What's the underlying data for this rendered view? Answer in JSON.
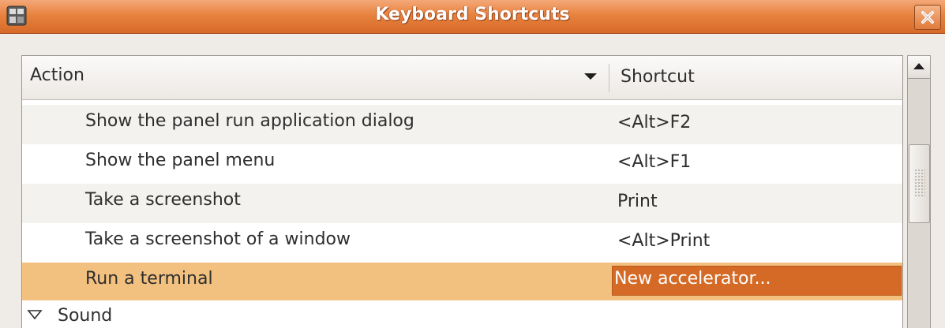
{
  "window": {
    "title": "Keyboard Shortcuts",
    "icon": "keyboard-shortcuts-app-icon",
    "close_icon": "close-icon"
  },
  "columns": {
    "action": "Action",
    "shortcut": "Shortcut",
    "sort_icon": "sort-descending-arrow-icon"
  },
  "rows": [
    {
      "action": "Show the panel run application dialog",
      "shortcut": "<Alt>F2"
    },
    {
      "action": "Show the panel menu",
      "shortcut": "<Alt>F1"
    },
    {
      "action": "Take a screenshot",
      "shortcut": "Print"
    },
    {
      "action": "Take a screenshot of a window",
      "shortcut": "<Alt>Print"
    },
    {
      "action": "Run a terminal",
      "shortcut_editor": "New accelerator...",
      "selected": true
    }
  ],
  "groups": [
    {
      "label": "Sound",
      "expanded": true,
      "expander_icon": "expander-open-triangle-icon"
    }
  ],
  "scrollbar": {
    "up_icon": "scroll-up-arrow-icon"
  },
  "colors": {
    "titlebar": "#e8823f",
    "selection": "#f3c17f",
    "editor": "#d56a26"
  }
}
